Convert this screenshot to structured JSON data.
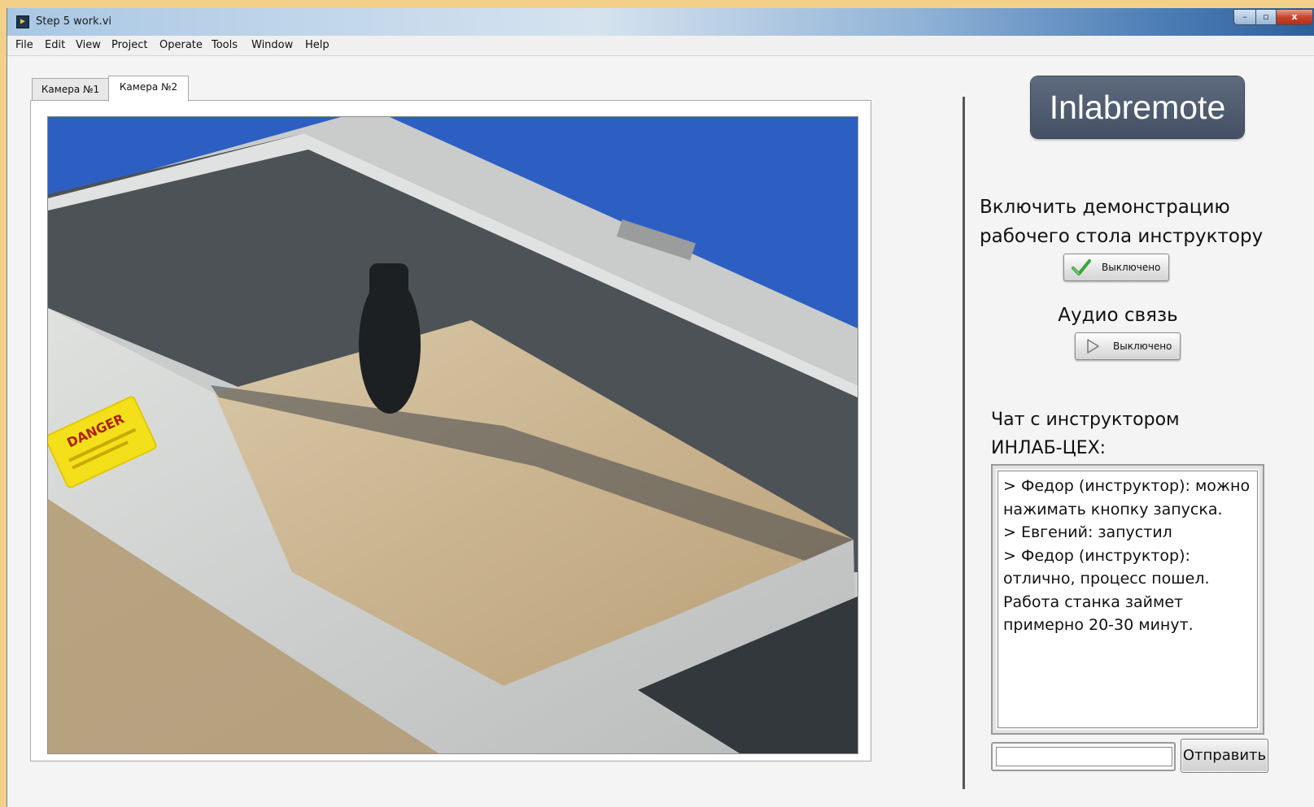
{
  "window": {
    "title": "Step 5 work.vi",
    "app_icon": "labview-vi-icon",
    "controls": {
      "minimize": "–",
      "maximize": "▫",
      "close": "x"
    }
  },
  "menu": [
    "File",
    "Edit",
    "View",
    "Project",
    "Operate",
    "Tools",
    "Window",
    "Help"
  ],
  "tabs": [
    {
      "label": "Камера №1",
      "selected": false
    },
    {
      "label": "Камера №2",
      "selected": true
    }
  ],
  "camera_view": {
    "icon": "camera-feed-image",
    "sign_text": "DANGER"
  },
  "brand": "Inlabremote",
  "desktop_demo": {
    "label": "Включить демонстрацию рабочего стола инструктору",
    "button_label": "Выключено",
    "button_icon": "checkmark-icon"
  },
  "audio": {
    "label": "Аудио связь",
    "button_label": "Выключено",
    "button_icon": "play-icon"
  },
  "chat": {
    "label": "Чат с инструктором ИНЛАБ-ЦЕХ:",
    "log": "> Федор (инструктор): можно нажимать кнопку запуска.\n> Евгений: запустил\n> Федор (инструктор): отлично, процесс пошел. Работа станка займет примерно 20-30 минут.",
    "input_value": "",
    "send_label": "Отправить"
  },
  "colors": {
    "brand_bg": "#4f5b6e",
    "accent_blue": "#2d5fc2",
    "danger_yellow": "#f3e01b"
  }
}
